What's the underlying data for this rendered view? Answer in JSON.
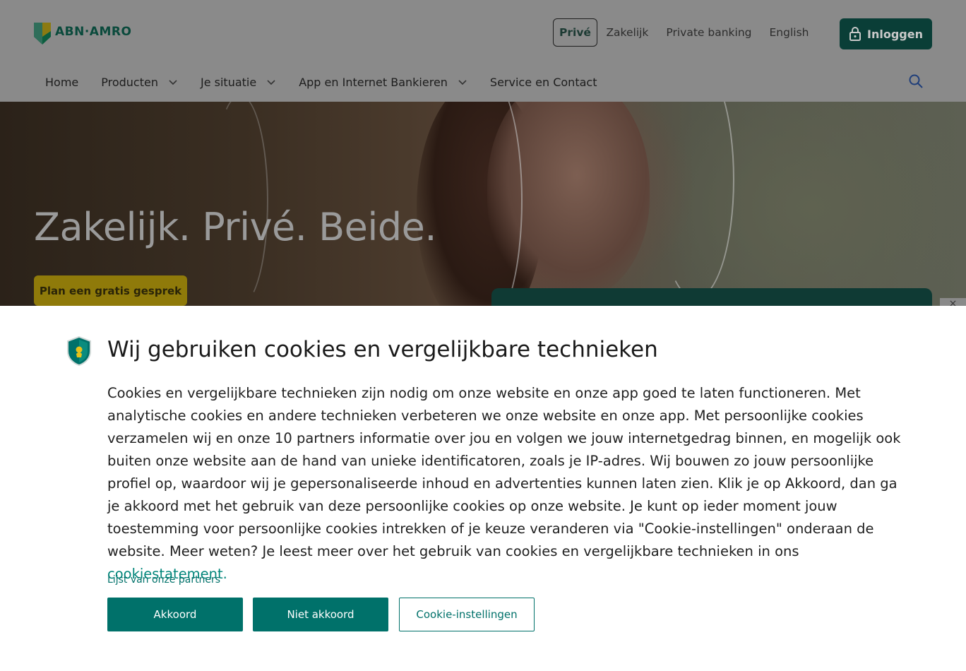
{
  "brand": {
    "name": "ABN·AMRO"
  },
  "segments": [
    {
      "label": "Privé",
      "active": true
    },
    {
      "label": "Zakelijk",
      "active": false
    },
    {
      "label": "Private banking",
      "active": false
    },
    {
      "label": "English",
      "active": false
    }
  ],
  "login": {
    "label": "Inloggen",
    "icon": "lock-icon"
  },
  "nav": {
    "items": [
      {
        "label": "Home",
        "has_dropdown": false
      },
      {
        "label": "Producten",
        "has_dropdown": true
      },
      {
        "label": "Je situatie",
        "has_dropdown": true
      },
      {
        "label": "App en Internet Bankieren",
        "has_dropdown": true
      },
      {
        "label": "Service en Contact",
        "has_dropdown": false
      }
    ],
    "search_icon": "search-icon"
  },
  "hero": {
    "title": "Zakelijk. Privé. Beide.",
    "cta_label": "Plan een gratis gesprek",
    "close_label": "×"
  },
  "cookie": {
    "title": "Wij gebruiken cookies en vergelijkbare technieken",
    "body": "Cookies en vergelijkbare technieken zijn nodig om onze website en onze app goed te laten functioneren. Met analytische cookies en andere technieken verbeteren we onze website en onze app. Met persoonlijke cookies verzamelen wij en onze 10 partners informatie over jou en volgen we jouw internetgedrag binnen, en mogelijk ook buiten onze website aan de hand van unieke identificatoren, zoals je IP-adres. Wij bouwen zo jouw persoonlijke profiel op, waardoor wij je gepersonaliseerde inhoud en advertenties kunnen laten zien. Klik je op Akkoord, dan ga je akkoord met het gebruik van deze persoonlijke cookies op onze website. Je kunt op ieder moment jouw toestemming voor persoonlijke cookies intrekken of je keuze veranderen via \"Cookie-instellingen\" onderaan de website. Meer weten? Je leest meer over het gebruik van cookies en vergelijkbare technieken in ons ",
    "statement_link": "cookiestatement.",
    "partners_link": "Lijst van onze partners",
    "buttons": {
      "accept": "Akkoord",
      "reject": "Niet akkoord",
      "settings": "Cookie-instellingen"
    }
  },
  "colors": {
    "brand_green": "#00716a",
    "login_bg": "#0a3e37",
    "cta_yellow": "#8f7a0a",
    "link": "#00857a"
  }
}
